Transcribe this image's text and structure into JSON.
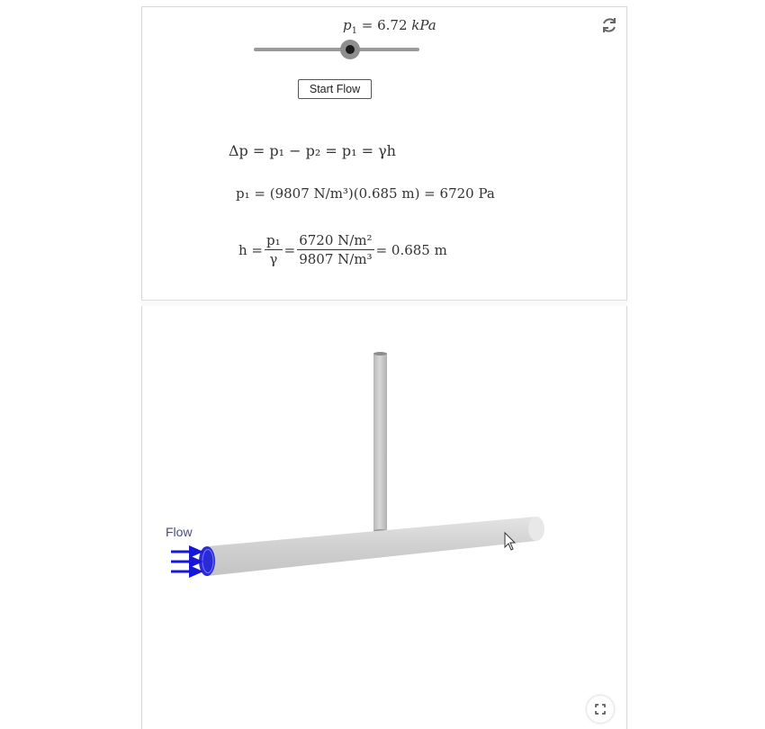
{
  "slider": {
    "label_var": "p",
    "label_sub": "1",
    "label_value": "= 6.72",
    "label_unit": "kPa",
    "value_fraction": 0.58
  },
  "button": {
    "start_label": "Start Flow"
  },
  "equations": {
    "eq1": "Δp = p₁ − p₂ = p₁ = γh",
    "eq2_lhs": "p₁ = (9807 N/m³)(0.685 m) = 6720 Pa",
    "eq3_lhs": "h =",
    "eq3_frac1_num": "p₁",
    "eq3_frac1_den": "γ",
    "eq3_frac2_num": "6720 N/m²",
    "eq3_frac2_den": "9807 N/m³",
    "eq3_rhs": "= 0.685 m"
  },
  "scene": {
    "flow_label": "Flow",
    "pipe_color": "#cfcfcf",
    "arrow_color": "#1616d8"
  },
  "icons": {
    "reset": "reset-icon",
    "fullscreen": "fullscreen-icon",
    "cursor": "cursor-icon"
  }
}
